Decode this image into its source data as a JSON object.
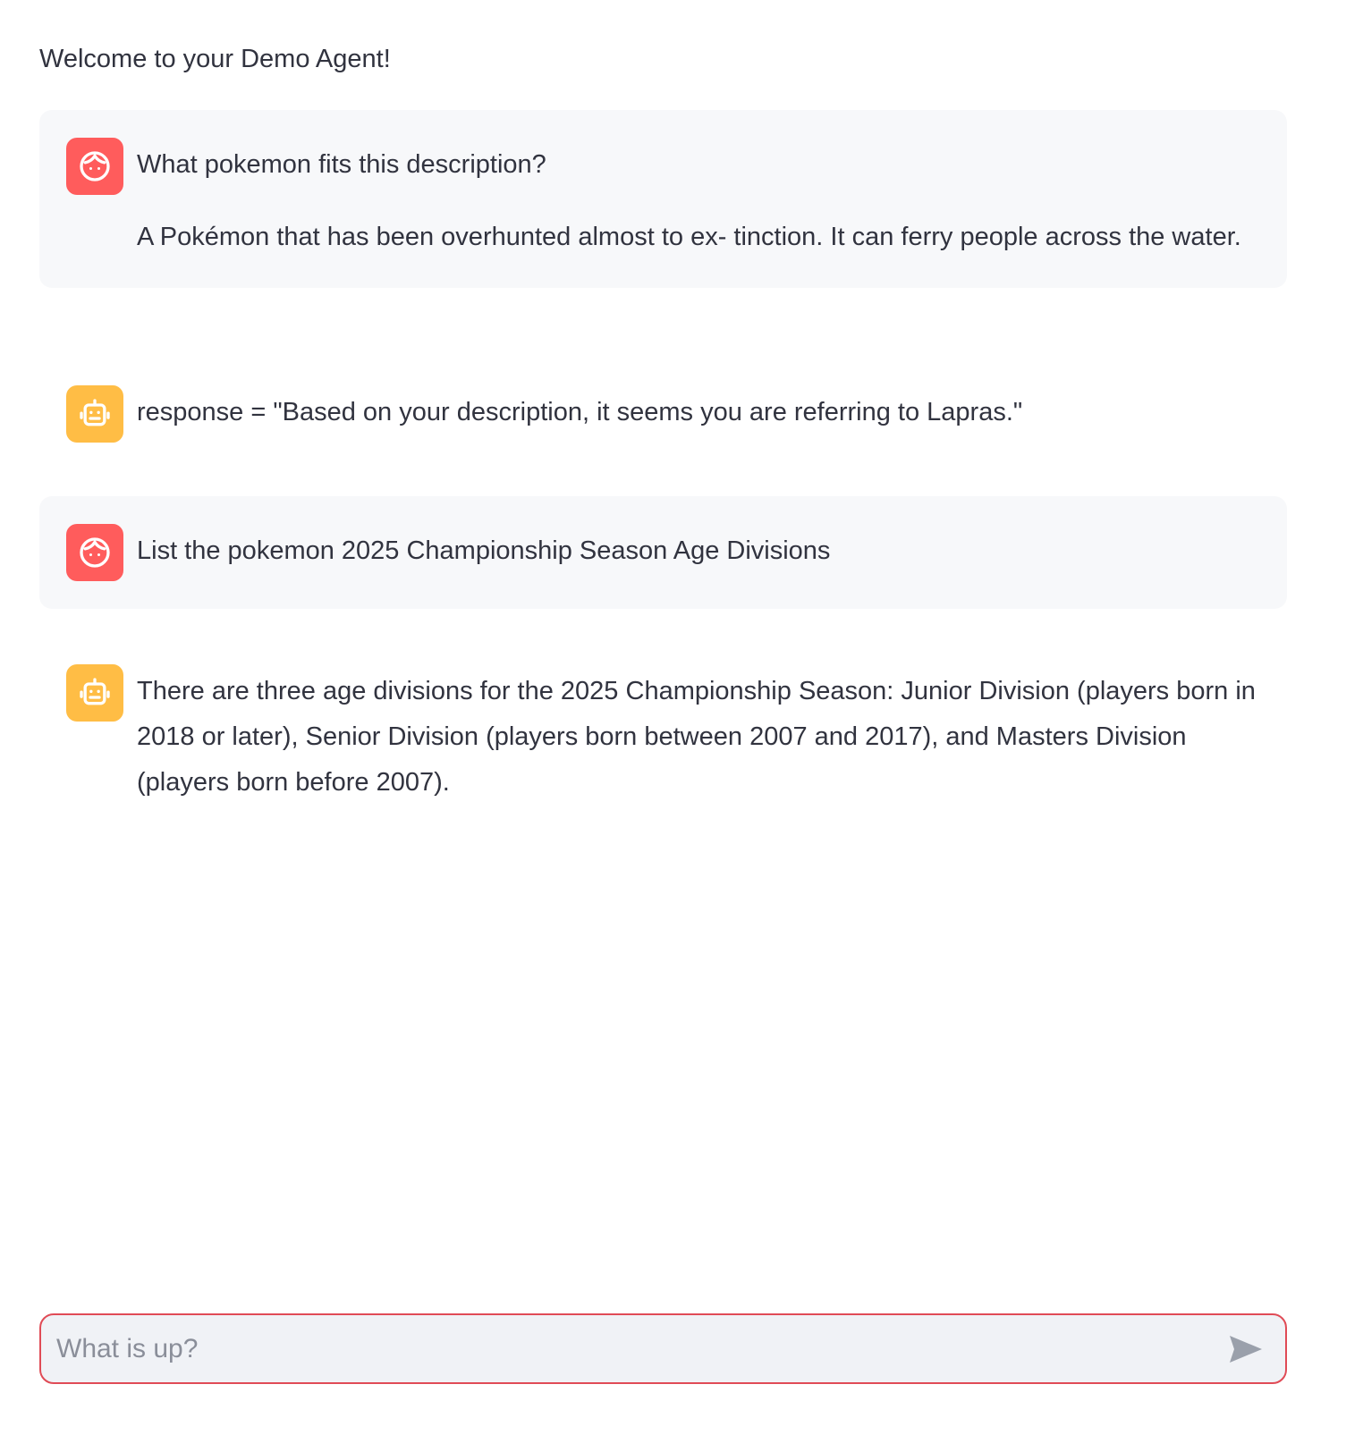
{
  "header": {
    "welcome_text": "Welcome to your Demo Agent!"
  },
  "colors": {
    "user_avatar": "#ff5c5c",
    "assistant_avatar": "#ffbd45",
    "user_bubble": "#f7f8fa",
    "input_border": "#e04b56",
    "input_bg": "#f0f2f6"
  },
  "messages": [
    {
      "role": "user",
      "avatar_icon": "face-icon",
      "paragraphs": [
        "What pokemon fits this description?",
        "A Pokémon that has been overhunted almost to ex- tinction. It can ferry people across the water."
      ]
    },
    {
      "role": "assistant",
      "avatar_icon": "robot-icon",
      "paragraphs": [
        "response = \"Based on your description, it seems you are referring to Lapras.\""
      ]
    },
    {
      "role": "user",
      "avatar_icon": "face-icon",
      "paragraphs": [
        "List the pokemon 2025 Championship Season Age Divisions"
      ]
    },
    {
      "role": "assistant",
      "avatar_icon": "robot-icon",
      "paragraphs": [
        "There are three age divisions for the 2025 Championship Season: Junior Division (players born in 2018 or later), Senior Division (players born between 2007 and 2017), and Masters Division (players born before 2007)."
      ]
    }
  ],
  "chat_input": {
    "placeholder": "What is up?",
    "value": "",
    "send_icon": "send-icon"
  }
}
